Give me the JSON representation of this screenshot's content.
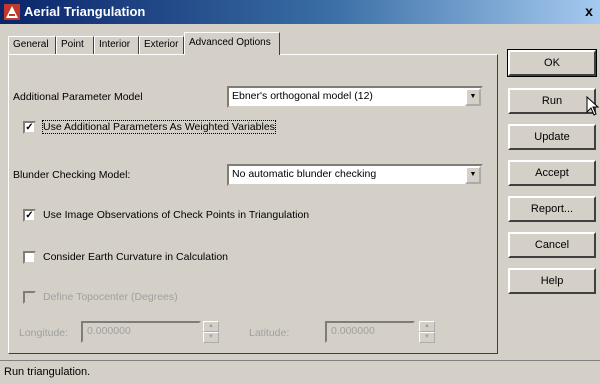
{
  "window": {
    "title": "Aerial Triangulation",
    "close_label": "x"
  },
  "tabs": [
    {
      "label": "General",
      "active": false
    },
    {
      "label": "Point",
      "active": false
    },
    {
      "label": "Interior",
      "active": false
    },
    {
      "label": "Exterior",
      "active": false
    },
    {
      "label": "Advanced Options",
      "active": true
    }
  ],
  "advanced": {
    "additional_param_label": "Additional Parameter Model",
    "additional_param_value": "Ebner's orthogonal model (12)",
    "weighted_vars_label": "Use Additional Parameters As Weighted Variables",
    "weighted_vars_checked": true,
    "blunder_label": "Blunder Checking Model:",
    "blunder_value": "No automatic blunder checking",
    "check_points_label": "Use Image Observations of Check Points in Triangulation",
    "check_points_checked": true,
    "earth_curvature_label": "Consider Earth Curvature in Calculation",
    "earth_curvature_checked": false,
    "topocenter_label": "Define Topocenter (Degrees)",
    "topocenter_checked": false,
    "longitude_label": "Longitude:",
    "longitude_value": "0.000000",
    "latitude_label": "Latitude:",
    "latitude_value": "0.000000"
  },
  "buttons": {
    "ok": "OK",
    "run": "Run",
    "update": "Update",
    "accept": "Accept",
    "report": "Report...",
    "cancel": "Cancel",
    "help": "Help"
  },
  "status": "Run triangulation.",
  "icons": {
    "app": "aerial-triangulation-app-icon",
    "check": "checkmark-icon",
    "dropdown": "dropdown-arrow-icon",
    "cursor": "mouse-pointer-icon"
  }
}
